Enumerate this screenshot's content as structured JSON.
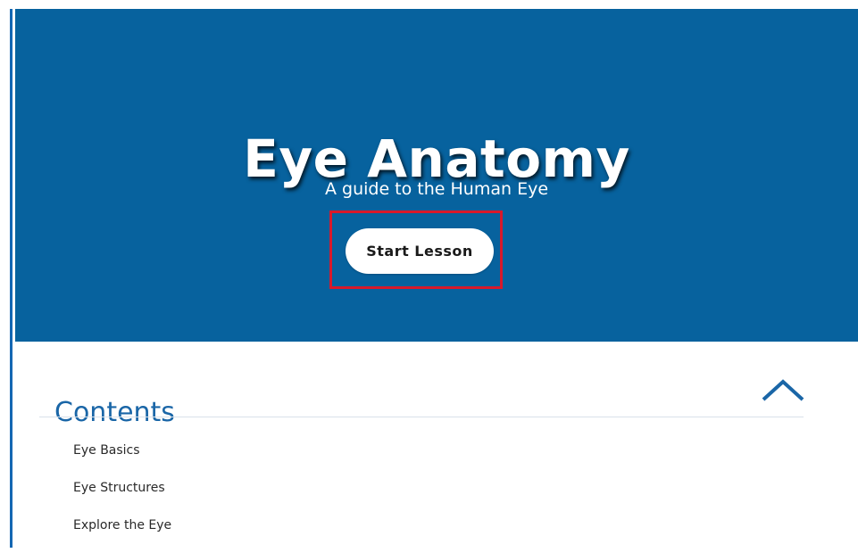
{
  "hero": {
    "title": "Eye Anatomy",
    "subtitle": "A guide to the Human Eye",
    "start_button_label": "Start Lesson",
    "background_color": "#07629e"
  },
  "contents": {
    "heading": "Contents",
    "toggle_icon": "chevron-up-icon",
    "items": [
      {
        "label": "Eye Basics"
      },
      {
        "label": "Eye Structures"
      },
      {
        "label": "Explore the Eye"
      }
    ]
  },
  "colors": {
    "accent": "#1a66a7",
    "highlight": "#d8192b"
  }
}
